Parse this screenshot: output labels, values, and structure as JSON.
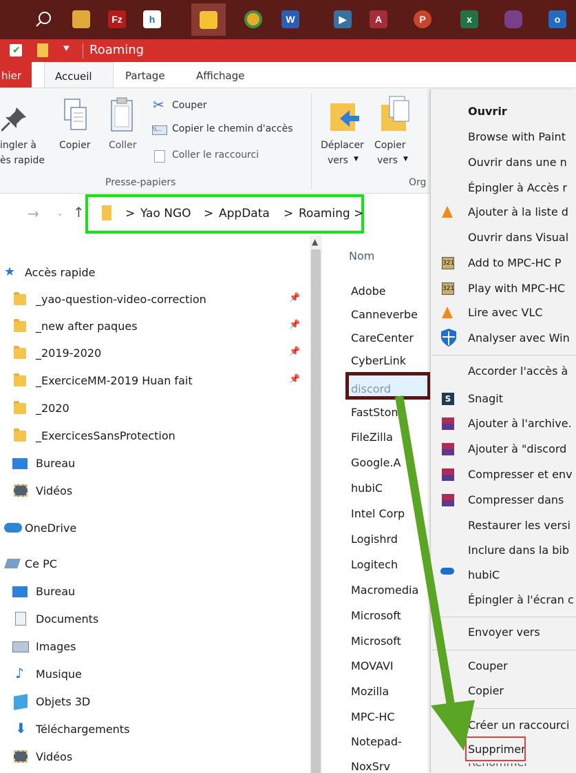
{
  "window": {
    "title": "Roaming"
  },
  "taskbar": {
    "items": [
      "search-icon",
      "app-icon",
      "filezilla-icon",
      "h-icon",
      "explorer-icon",
      "chrome-icon",
      "word-icon",
      "media-icon",
      "access-icon",
      "powerpoint-icon",
      "excel-icon",
      "nox-icon",
      "outlook-icon"
    ],
    "labels": {
      "filezilla": "Fz",
      "h": "h",
      "word": "W",
      "access": "A",
      "powerpoint": "P",
      "excel": "x",
      "outlook": "o"
    }
  },
  "ribbon": {
    "tabs": {
      "fichier": "hier",
      "accueil": "Accueil",
      "partage": "Partage",
      "affichage": "Affichage"
    },
    "pin_label_1": "ingler à",
    "pin_label_2": "ès rapide",
    "copier": "Copier",
    "coller": "Coller",
    "couper": "Couper",
    "copier_chemin": "Copier le chemin d'accès",
    "coller_raccourci": "Coller le raccourci",
    "presse_papiers": "Presse-papiers",
    "deplacer_1": "Déplacer",
    "deplacer_2": "vers",
    "copier_vers_1": "Copier",
    "copier_vers_2": "vers",
    "organiser": "Org"
  },
  "address": {
    "segments": [
      "Yao NGO",
      "AppData",
      "Roaming"
    ],
    "separator": ">"
  },
  "nav": {
    "quick_access": "Accès rapide",
    "pinned": [
      "_yao-question-video-correction",
      "_new after paques",
      "_2019-2020",
      "_ExerciceMM-2019 Huan fait"
    ],
    "recent": [
      "_2020",
      "_ExercicesSansProtection"
    ],
    "bureau": "Bureau",
    "videos": "Vidéos",
    "onedrive": "OneDrive",
    "ce_pc": "Ce PC",
    "pc_items": [
      "Bureau",
      "Documents",
      "Images",
      "Musique",
      "Objets 3D",
      "Téléchargements",
      "Vidéos"
    ]
  },
  "files": {
    "header": "Nom",
    "items": [
      "Adobe",
      "Canneverbe",
      "CareCenter",
      "CyberLink",
      "discord",
      "FastStone",
      "FileZilla",
      "Google.A",
      "hubiC",
      "Intel Corp",
      "Logishrd",
      "Logitech",
      "Macromedia",
      "Microsoft",
      "Microsoft",
      "MOVAVI",
      "Mozilla",
      "MPC-HC",
      "Notepad-",
      "NoxSrv"
    ],
    "selected": "discord"
  },
  "context_menu": {
    "items": [
      "Ouvrir",
      "Browse with Paint",
      "Ouvrir dans une n",
      "Épingler à Accès r",
      "Ajouter à la liste d",
      "Ouvrir dans Visual",
      "Add to MPC-HC P",
      "Play with MPC-HC",
      "Lire avec VLC",
      "Analyser avec Win",
      "Accorder l'accès à",
      "Snagit",
      "Ajouter à l'archive.",
      "Ajouter à \"discord",
      "Compresser et env",
      "Compresser dans",
      "Restaurer les versi",
      "Inclure dans la bib",
      "hubiC",
      "Épingler à l'écran c",
      "Envoyer vers",
      "Couper",
      "Copier",
      "Créer un raccourci",
      "Supprimer",
      "Renommer"
    ],
    "mpc_glyph": "321",
    "snagit_glyph": "S"
  },
  "colors": {
    "highlight_green": "#16e216",
    "highlight_maroon": "#5a1414",
    "arrow_green": "#5aa624",
    "delete_box": "#e04040",
    "title_red": "#d42f2a"
  }
}
